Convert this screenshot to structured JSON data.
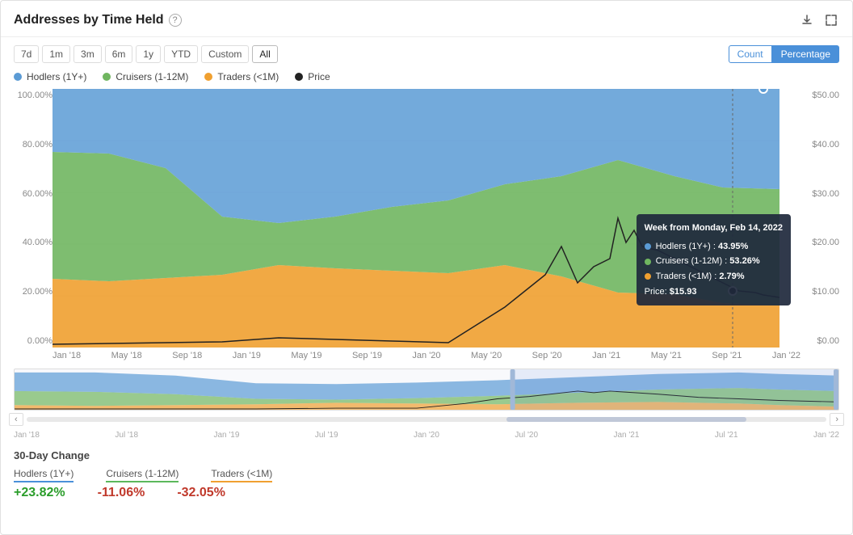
{
  "header": {
    "title": "Addresses by Time Held",
    "help_label": "?",
    "download_icon": "⬇",
    "expand_icon": "⤢"
  },
  "toolbar": {
    "time_buttons": [
      "7d",
      "1m",
      "3m",
      "6m",
      "1y",
      "YTD",
      "Custom",
      "All"
    ],
    "active_time": "All",
    "view_buttons": [
      "Count",
      "Percentage"
    ],
    "active_view": "Percentage"
  },
  "legend": [
    {
      "label": "Hodlers (1Y+)",
      "color": "#5b9bd5"
    },
    {
      "label": "Cruisers (1-12M)",
      "color": "#70b660"
    },
    {
      "label": "Traders (<1M)",
      "color": "#f0a030"
    },
    {
      "label": "Price",
      "color": "#222"
    }
  ],
  "y_axis_left": [
    "100.00%",
    "80.00%",
    "60.00%",
    "40.00%",
    "20.00%",
    "0.00%"
  ],
  "y_axis_right": [
    "$50.00",
    "$40.00",
    "$30.00",
    "$20.00",
    "$10.00",
    "$0.00"
  ],
  "x_axis": [
    "Jan '18",
    "May '18",
    "Sep '18",
    "Jan '19",
    "May '19",
    "Sep '19",
    "Jan '20",
    "May '20",
    "Sep '20",
    "Jan '21",
    "May '21",
    "Sep '21",
    "Jan '22"
  ],
  "mini_x_axis": [
    "Jan '18",
    "Jul '18",
    "Jan '19",
    "Jul '19",
    "Jan '20",
    "Jul '20",
    "Jan '21",
    "Jul '21",
    "Jan '22"
  ],
  "tooltip": {
    "week_label": "Week from Monday, Feb 14, 2022",
    "rows": [
      {
        "label": "Hodlers (1Y+) :",
        "value": "43.95%",
        "color": "#5b9bd5"
      },
      {
        "label": "Cruisers (1-12M) :",
        "value": "53.26%",
        "color": "#70b660"
      },
      {
        "label": "Traders (<1M) :",
        "value": "2.79%",
        "color": "#f0a030"
      },
      {
        "label": "Price:",
        "value": "$15.93",
        "color": null
      }
    ]
  },
  "changes": {
    "title": "30-Day Change",
    "items": [
      {
        "label": "Hodlers (1Y+)",
        "value": "+23.82%",
        "type": "positive",
        "class": "hodlers"
      },
      {
        "label": "Cruisers (1-12M)",
        "value": "-11.06%",
        "type": "negative",
        "class": "cruisers"
      },
      {
        "label": "Traders (<1M)",
        "value": "-32.05%",
        "type": "negative",
        "class": "traders"
      }
    ]
  }
}
